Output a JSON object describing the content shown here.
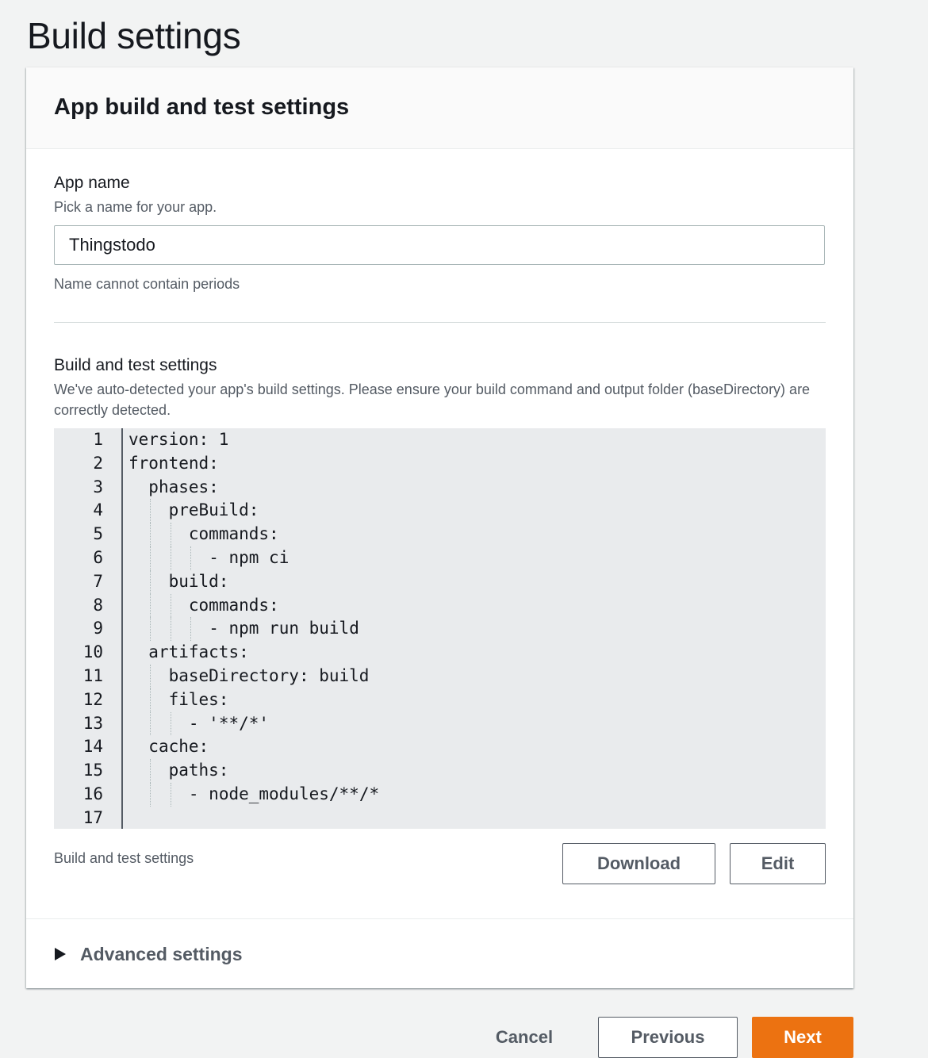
{
  "page": {
    "title": "Build settings"
  },
  "panel": {
    "header_title": "App build and test settings",
    "app_name": {
      "label": "App name",
      "description": "Pick a name for your app.",
      "value": "Thingstodo",
      "constraint": "Name cannot contain periods"
    },
    "build_settings": {
      "label": "Build and test settings",
      "description": "We've auto-detected your app's build settings. Please ensure your build command and output folder (baseDirectory) are correctly detected.",
      "caption": "Build and test settings",
      "download_label": "Download",
      "edit_label": "Edit"
    },
    "code_lines": [
      {
        "num": "1",
        "text": "version: 1",
        "indent": 0
      },
      {
        "num": "2",
        "text": "frontend:",
        "indent": 0
      },
      {
        "num": "3",
        "text": "phases:",
        "indent": 1
      },
      {
        "num": "4",
        "text": "preBuild:",
        "indent": 2
      },
      {
        "num": "5",
        "text": "commands:",
        "indent": 3
      },
      {
        "num": "6",
        "text": "- npm ci",
        "indent": 4
      },
      {
        "num": "7",
        "text": "build:",
        "indent": 2
      },
      {
        "num": "8",
        "text": "commands:",
        "indent": 3
      },
      {
        "num": "9",
        "text": "- npm run build",
        "indent": 4
      },
      {
        "num": "10",
        "text": "artifacts:",
        "indent": 1
      },
      {
        "num": "11",
        "text": "baseDirectory: build",
        "indent": 2
      },
      {
        "num": "12",
        "text": "files:",
        "indent": 2
      },
      {
        "num": "13",
        "text": "- '**/*'",
        "indent": 3
      },
      {
        "num": "14",
        "text": "cache:",
        "indent": 1
      },
      {
        "num": "15",
        "text": "paths:",
        "indent": 2
      },
      {
        "num": "16",
        "text": "- node_modules/**/*",
        "indent": 3
      },
      {
        "num": "17",
        "text": "",
        "indent": 0
      }
    ],
    "advanced_label": "Advanced settings"
  },
  "footer": {
    "cancel_label": "Cancel",
    "previous_label": "Previous",
    "next_label": "Next"
  },
  "colors": {
    "primary_button": "#ec7211",
    "editor_background": "#e9ebed",
    "text_secondary": "#545b64"
  },
  "icons": {
    "advanced_toggle": "caret-right-icon"
  }
}
